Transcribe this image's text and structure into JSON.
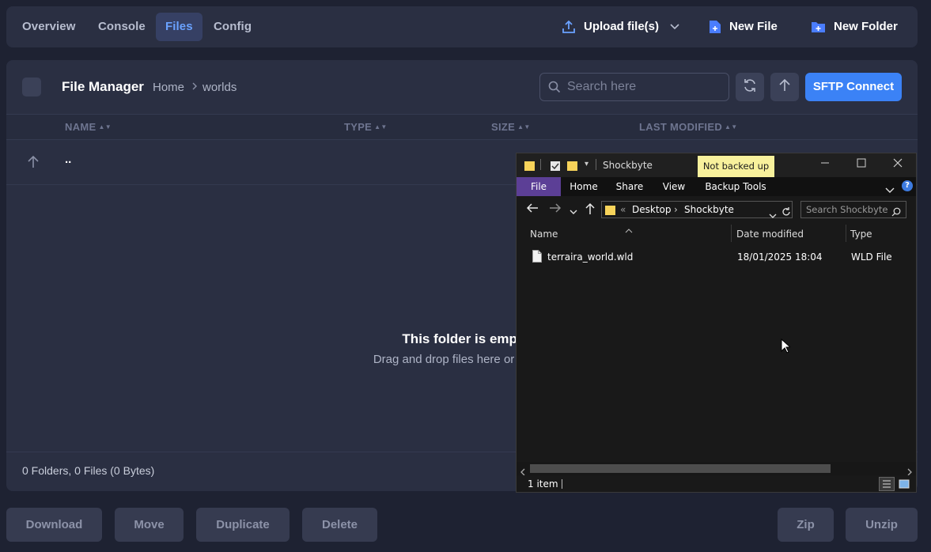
{
  "nav": {
    "tabs": [
      {
        "label": "Overview"
      },
      {
        "label": "Console"
      },
      {
        "label": "Files",
        "active": true
      },
      {
        "label": "Config"
      }
    ],
    "upload_label": "Upload file(s)",
    "new_file_label": "New File",
    "new_folder_label": "New Folder"
  },
  "file_manager": {
    "title": "File Manager",
    "breadcrumb": [
      "Home",
      "worlds"
    ],
    "search_placeholder": "Search here",
    "sftp_label": "SFTP Connect",
    "columns": [
      "NAME",
      "TYPE",
      "SIZE",
      "LAST MODIFIED"
    ],
    "up_row_label": "..",
    "empty_title": "This folder is empt",
    "empty_subtitle": "Drag and drop files here or create",
    "summary": "0 Folders, 0 Files (0 Bytes)"
  },
  "actions": {
    "download": "Download",
    "move": "Move",
    "duplicate": "Duplicate",
    "delete": "Delete",
    "zip": "Zip",
    "unzip": "Unzip"
  },
  "explorer": {
    "window_title": "Shockbyte",
    "badge": "Not backed up",
    "ribbon_tabs": [
      "File",
      "Home",
      "Share",
      "View",
      "Backup Tools"
    ],
    "address": [
      "Desktop",
      "Shockbyte"
    ],
    "search_placeholder": "Search Shockbyte",
    "columns": [
      "Name",
      "Date modified",
      "Type"
    ],
    "files": [
      {
        "name": "terraira_world.wld",
        "modified": "18/01/2025 18:04",
        "type": "WLD File"
      }
    ],
    "status": "1 item"
  },
  "colors": {
    "background": "#1e2232",
    "panel": "#2a2f42",
    "accent": "#3b82f6",
    "active_tab_text": "#6aa2ff",
    "explorer_file_tab": "#5c3f96",
    "badge": "#f8f19c"
  }
}
